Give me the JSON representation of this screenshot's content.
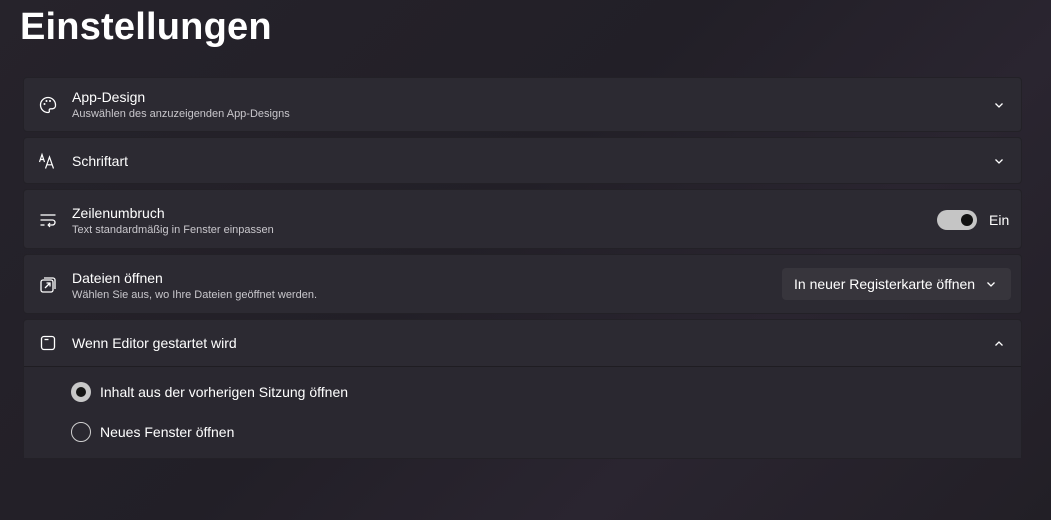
{
  "page": {
    "title": "Einstellungen"
  },
  "settings": {
    "app_design": {
      "title": "App-Design",
      "subtitle": "Auswählen des anzuzeigenden App-Designs",
      "icon": "palette-icon"
    },
    "font": {
      "title": "Schriftart",
      "icon": "font-icon"
    },
    "word_wrap": {
      "title": "Zeilenumbruch",
      "subtitle": "Text standardmäßig in Fenster einpassen",
      "icon": "word-wrap-icon",
      "toggle_state": "Ein",
      "toggle_on": true
    },
    "open_files": {
      "title": "Dateien öffnen",
      "subtitle": "Wählen Sie aus, wo Ihre Dateien geöffnet werden.",
      "icon": "open-in-new-icon",
      "selected_option": "In neuer Registerkarte öffnen"
    },
    "startup": {
      "title": "Wenn Editor gestartet wird",
      "icon": "window-icon",
      "expanded": true,
      "options": [
        {
          "label": "Inhalt aus der vorherigen Sitzung öffnen",
          "selected": true
        },
        {
          "label": "Neues Fenster öffnen",
          "selected": false
        }
      ]
    }
  },
  "colors": {
    "background": "#24212a",
    "card": "#2c2a32",
    "toggle_on": "#c5c5c5"
  }
}
